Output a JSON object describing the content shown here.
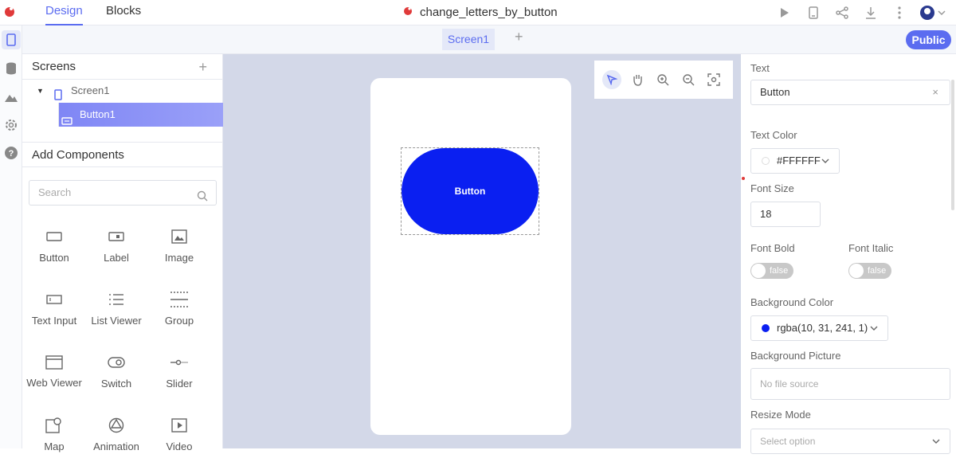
{
  "topbar": {
    "tabs": [
      "Design",
      "Blocks"
    ],
    "project_name": "change_letters_by_button"
  },
  "screenbar": {
    "screen_tab": "Screen1",
    "add_label": "+",
    "public_label": "Public"
  },
  "screens_panel": {
    "title": "Screens",
    "add_label": "+",
    "tree": [
      {
        "label": "Screen1"
      },
      {
        "label": "Button1"
      }
    ]
  },
  "components_panel": {
    "title": "Add Components",
    "search_placeholder": "Search",
    "items": [
      {
        "label": "Button",
        "icon": "button-icon"
      },
      {
        "label": "Label",
        "icon": "label-icon"
      },
      {
        "label": "Image",
        "icon": "image-icon"
      },
      {
        "label": "Text Input",
        "icon": "text-input-icon"
      },
      {
        "label": "List Viewer",
        "icon": "list-viewer-icon"
      },
      {
        "label": "Group",
        "icon": "group-icon"
      },
      {
        "label": "Web Viewer",
        "icon": "web-viewer-icon"
      },
      {
        "label": "Switch",
        "icon": "switch-icon"
      },
      {
        "label": "Slider",
        "icon": "slider-icon"
      },
      {
        "label": "Map",
        "icon": "map-icon"
      },
      {
        "label": "Animation",
        "icon": "animation-icon"
      },
      {
        "label": "Video",
        "icon": "video-icon"
      }
    ]
  },
  "canvas": {
    "button_text": "Button",
    "button_color": "#0a1ff1"
  },
  "properties": {
    "text_label": "Text",
    "text_value": "Button",
    "text_color_label": "Text Color",
    "text_color_value": "#FFFFFF",
    "font_size_label": "Font Size",
    "font_size_value": "18",
    "font_bold_label": "Font Bold",
    "font_bold_value": "false",
    "font_italic_label": "Font Italic",
    "font_italic_value": "false",
    "bg_color_label": "Background Color",
    "bg_color_value": "rgba(10, 31, 241, 1)",
    "bg_picture_label": "Background Picture",
    "bg_picture_value": "No file source",
    "resize_mode_label": "Resize Mode",
    "resize_mode_placeholder": "Select option"
  },
  "colors": {
    "accent": "#5b6cf0",
    "button_blue": "#0a1ff1"
  }
}
